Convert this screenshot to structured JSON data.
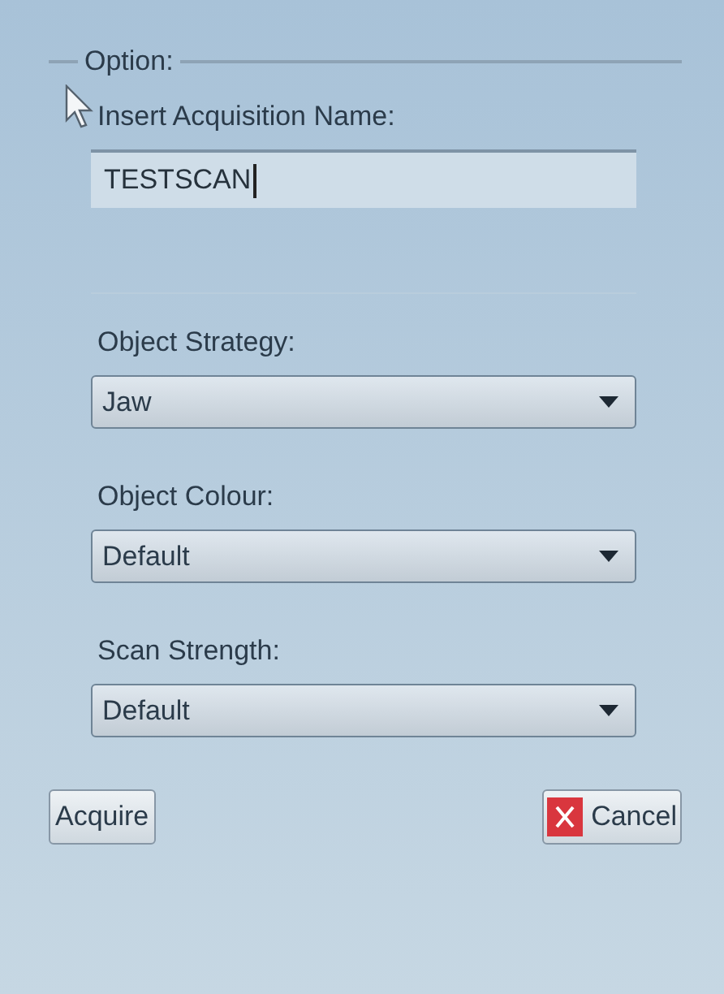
{
  "group": {
    "title": "Option:"
  },
  "name_field": {
    "label": "Insert Acquisition Name:",
    "value": "TESTSCAN",
    "focused": true
  },
  "selects": [
    {
      "label": "Object Strategy:",
      "value": "Jaw"
    },
    {
      "label": "Object Colour:",
      "value": "Default"
    },
    {
      "label": "Scan Strength:",
      "value": "Default"
    }
  ],
  "buttons": [
    {
      "label": "Acquire",
      "kind": "plain"
    },
    {
      "label": "Cancel",
      "kind": "cancel"
    }
  ]
}
